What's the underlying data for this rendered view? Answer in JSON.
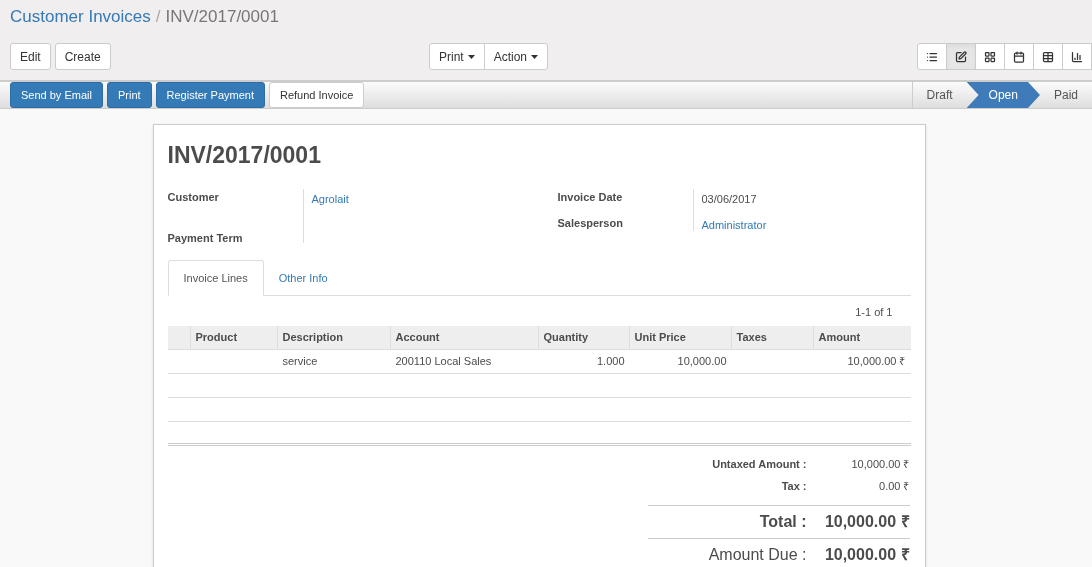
{
  "breadcrumb": {
    "parent": "Customer Invoices",
    "separator": "/",
    "current": "INV/2017/0001"
  },
  "left_buttons": [
    "Edit",
    "Create"
  ],
  "dropdowns": [
    "Print",
    "Action"
  ],
  "views": [
    {
      "kind": "list",
      "selected": false
    },
    {
      "kind": "form",
      "selected": true
    },
    {
      "kind": "kanban",
      "selected": false
    },
    {
      "kind": "calendar",
      "selected": false
    },
    {
      "kind": "pivot",
      "selected": false
    },
    {
      "kind": "graph",
      "selected": false
    }
  ],
  "actions": [
    {
      "label": "Send by Email",
      "primary": true
    },
    {
      "label": "Print",
      "primary": true
    },
    {
      "label": "Register Payment",
      "primary": true
    },
    {
      "label": "Refund Invoice",
      "primary": false
    }
  ],
  "stages": [
    {
      "label": "Draft",
      "selected": false
    },
    {
      "label": "Open",
      "selected": true
    },
    {
      "label": "Paid",
      "selected": false
    }
  ],
  "title": "INV/2017/0001",
  "left_fields": [
    {
      "label": "Customer",
      "value": "Agrolait",
      "link": true
    },
    {
      "label": "Payment Term"
    }
  ],
  "right_fields": [
    {
      "label": "Invoice Date",
      "value": "03/06/2017",
      "link": false
    },
    {
      "label": "Salesperson",
      "value": "Administrator",
      "link": true
    }
  ],
  "tabs": [
    {
      "label": "Invoice Lines",
      "selected": true
    },
    {
      "label": "Other Info",
      "selected": false
    }
  ],
  "pager": "1-1 of 1",
  "table": {
    "columns": [
      "Product",
      "Description",
      "Account",
      "Quantity",
      "Unit Price",
      "Taxes",
      "Amount"
    ],
    "rows": [
      [
        "",
        "service",
        "200110 Local Sales",
        "1.000",
        "10,000.00",
        "",
        "10,000.00 ₹"
      ]
    ]
  },
  "totals": [
    {
      "kind": "small",
      "label": "Untaxed Amount :",
      "value": "10,000.00 ₹"
    },
    {
      "kind": "small",
      "label": "Tax :",
      "value": "0.00 ₹"
    },
    {
      "kind": "total",
      "label": "Total :",
      "value": "10,000.00 ₹"
    },
    {
      "kind": "due",
      "label": "Amount Due :",
      "value": "10,000.00 ₹"
    }
  ]
}
